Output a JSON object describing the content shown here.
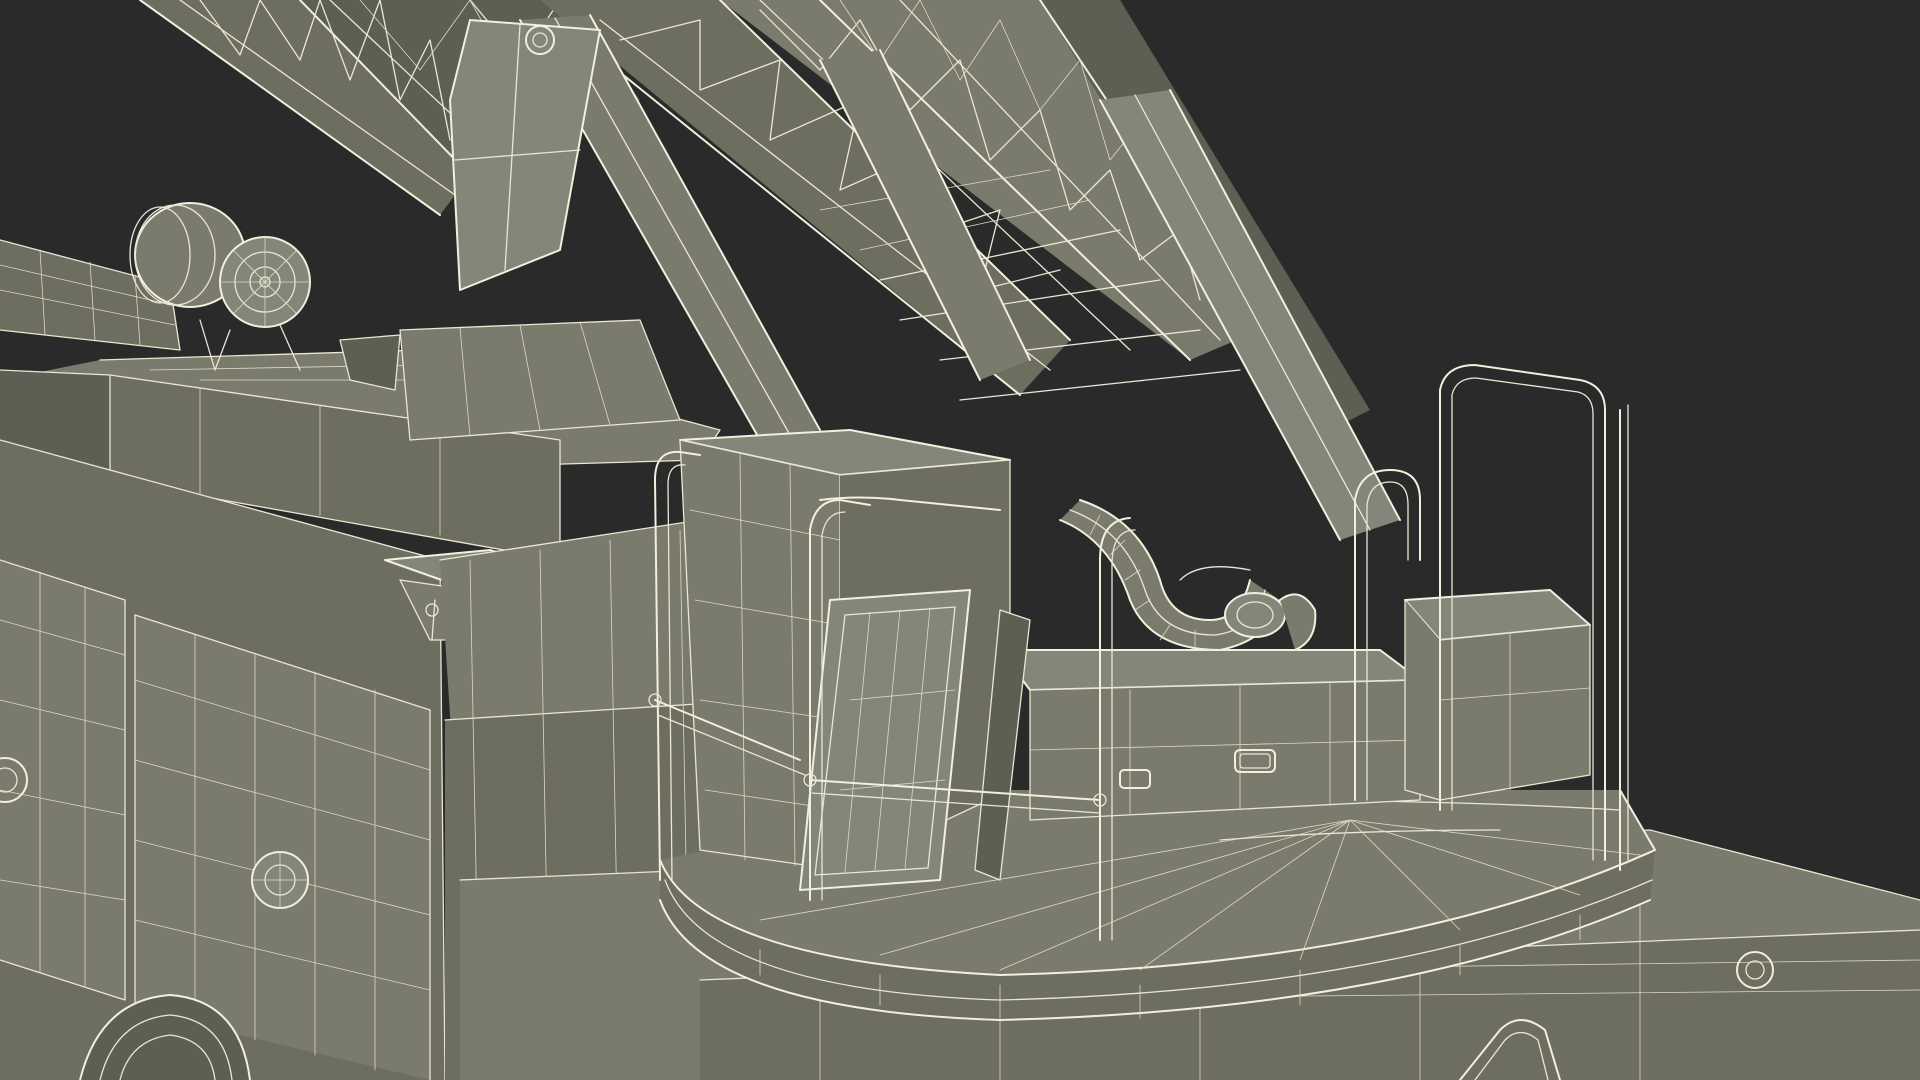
{
  "scene": {
    "subject": "",
    "background_color": "#2a2a2a",
    "model_color": "#6d6e60",
    "wire_color": "#e9e7d4"
  }
}
